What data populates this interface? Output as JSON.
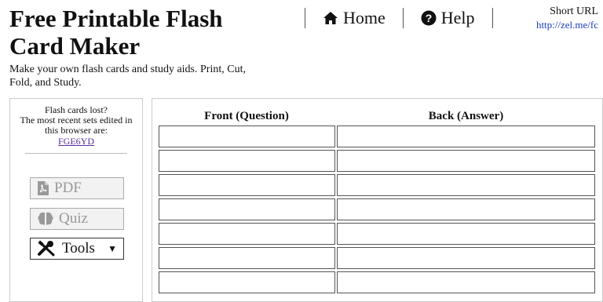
{
  "header": {
    "title": "Free Printable Flash Card Maker",
    "subtitle": "Make your own flash cards and study aids. Print, Cut, Fold, and Study."
  },
  "nav": {
    "home_label": "Home",
    "help_label": "Help"
  },
  "short_url": {
    "label": "Short URL",
    "link": "http://zel.me/fc"
  },
  "sidebar": {
    "lost_line1": "Flash cards lost?",
    "lost_line2": "The most recent sets edited in this browser are:",
    "recent_set": "FGE6YD",
    "pdf_label": "PDF",
    "quiz_label": "Quiz",
    "tools_label": "Tools"
  },
  "cards": {
    "front_header": "Front (Question)",
    "back_header": "Back (Answer)",
    "rows": [
      "",
      "",
      "",
      "",
      "",
      "",
      ""
    ]
  },
  "colors": {
    "link_blue": "#1a3cc4",
    "visited_purple": "#5a2fa0",
    "disabled_text": "#999999"
  }
}
